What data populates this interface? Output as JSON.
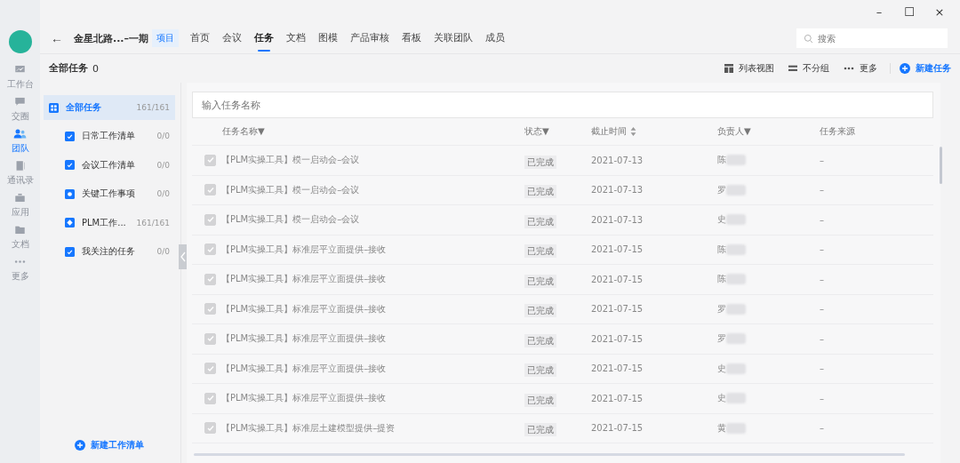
{
  "window": {
    "controls": [
      "–",
      "☐",
      "×"
    ]
  },
  "rail": {
    "items": [
      {
        "kind": "chart",
        "label": "工作台",
        "selected": false
      },
      {
        "kind": "chat",
        "label": "交圈",
        "selected": false
      },
      {
        "kind": "team",
        "label": "团队",
        "selected": true
      },
      {
        "kind": "contacts",
        "label": "通讯录",
        "selected": false
      },
      {
        "kind": "apps",
        "label": "应用",
        "selected": false
      },
      {
        "kind": "docs",
        "label": "文档",
        "selected": false
      },
      {
        "kind": "more",
        "label": "更多",
        "selected": false
      }
    ]
  },
  "header": {
    "back": "←",
    "project": "金星北路...–一期",
    "badge": "项目",
    "tabs": [
      {
        "label": "首页",
        "selected": false
      },
      {
        "label": "会议",
        "selected": false
      },
      {
        "label": "任务",
        "selected": true
      },
      {
        "label": "文档",
        "selected": false
      },
      {
        "label": "图模",
        "selected": false
      },
      {
        "label": "产品审核",
        "selected": false
      },
      {
        "label": "看板",
        "selected": false
      },
      {
        "label": "关联团队",
        "selected": false
      },
      {
        "label": "成员",
        "selected": false
      }
    ],
    "search": {
      "placeholder": "搜索"
    }
  },
  "toolbar": {
    "title": "全部任务",
    "count": "0",
    "actions": [
      {
        "kind": "list",
        "label": "列表视图"
      },
      {
        "kind": "group",
        "label": "不分组"
      },
      {
        "kind": "more",
        "label": "更多"
      }
    ],
    "new_task": "新建任务"
  },
  "lists": {
    "items": [
      {
        "kind": "all",
        "label": "全部任务",
        "count": "161/161",
        "selected": true
      },
      {
        "kind": "check",
        "label": "日常工作清单",
        "count": "0/0",
        "selected": false
      },
      {
        "kind": "check",
        "label": "会议工作清单",
        "count": "0/0",
        "selected": false
      },
      {
        "kind": "key",
        "label": "关键工作事项",
        "count": "0/0",
        "selected": false
      },
      {
        "kind": "plm",
        "label": "PLM工作...",
        "count": "161/161",
        "selected": false
      },
      {
        "kind": "check",
        "label": "我关注的任务",
        "count": "0/0",
        "selected": false
      }
    ],
    "new_list": "新建工作清单"
  },
  "table": {
    "filter": {
      "placeholder": "输入任务名称"
    },
    "columns": [
      {
        "label": "任务名称▼",
        "sort": false
      },
      {
        "label": "状态▼",
        "sort": false
      },
      {
        "label": "截止时间",
        "sort": true
      },
      {
        "label": "负责人▼",
        "sort": false
      },
      {
        "label": "任务来源",
        "sort": false
      }
    ],
    "rows": [
      {
        "checked": true,
        "name": "【PLM实操工具】模一启动会–会议",
        "status": "已完成",
        "due": "2021-07-13",
        "owner": "陈",
        "source": "–"
      },
      {
        "checked": true,
        "name": "【PLM实操工具】模一启动会–会议",
        "status": "已完成",
        "due": "2021-07-13",
        "owner": "罗",
        "source": "–"
      },
      {
        "checked": true,
        "name": "【PLM实操工具】模一启动会–会议",
        "status": "已完成",
        "due": "2021-07-13",
        "owner": "史",
        "source": "–"
      },
      {
        "checked": true,
        "name": "【PLM实操工具】标准层平立面提供–接收",
        "status": "已完成",
        "due": "2021-07-15",
        "owner": "陈",
        "source": "–"
      },
      {
        "checked": true,
        "name": "【PLM实操工具】标准层平立面提供–接收",
        "status": "已完成",
        "due": "2021-07-15",
        "owner": "陈",
        "source": "–"
      },
      {
        "checked": true,
        "name": "【PLM实操工具】标准层平立面提供–接收",
        "status": "已完成",
        "due": "2021-07-15",
        "owner": "罗",
        "source": "–"
      },
      {
        "checked": true,
        "name": "【PLM实操工具】标准层平立面提供–接收",
        "status": "已完成",
        "due": "2021-07-15",
        "owner": "罗",
        "source": "–"
      },
      {
        "checked": true,
        "name": "【PLM实操工具】标准层平立面提供–接收",
        "status": "已完成",
        "due": "2021-07-15",
        "owner": "史",
        "source": "–"
      },
      {
        "checked": true,
        "name": "【PLM实操工具】标准层平立面提供–接收",
        "status": "已完成",
        "due": "2021-07-15",
        "owner": "史",
        "source": "–"
      },
      {
        "checked": true,
        "name": "【PLM实操工具】标准层土建模型提供–提资",
        "status": "已完成",
        "due": "2021-07-15",
        "owner": "黄",
        "source": "–"
      }
    ]
  }
}
